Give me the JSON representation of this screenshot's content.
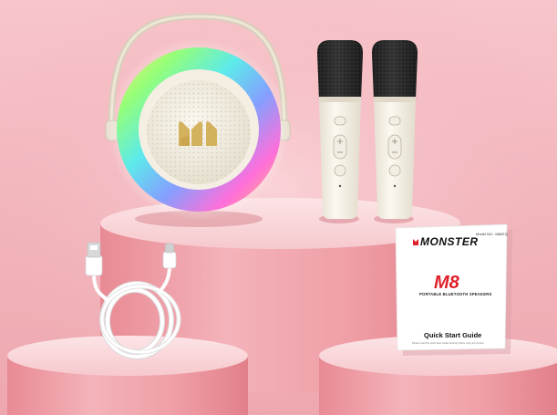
{
  "scene": {
    "background_color": "#f3b9c0",
    "pedestal_color": "#ee9ea6",
    "pedestal_top_color": "#fad9dc"
  },
  "speaker": {
    "logo": "monster-m-logo",
    "body_color": "#f4efe2",
    "ring_colors": [
      "#ffe24a",
      "#7dff5c",
      "#39e6e6",
      "#6a8bff",
      "#ff4fd2",
      "#ffb34a"
    ]
  },
  "microphones": [
    {
      "name": "left"
    },
    {
      "name": "right"
    }
  ],
  "cable": {
    "color": "#ffffff",
    "connectors": [
      "usb-a",
      "usb-c"
    ]
  },
  "booklet": {
    "brand": "MONSTER",
    "model_no": "Model NO.: M8ATQ",
    "model": "M8",
    "subtitle": "PORTABLE BLUETOOTH SPEAKERS",
    "guide_title": "Quick Start Guide",
    "fine_print": "Please read this Quick Start Guide carefully before using the product"
  }
}
